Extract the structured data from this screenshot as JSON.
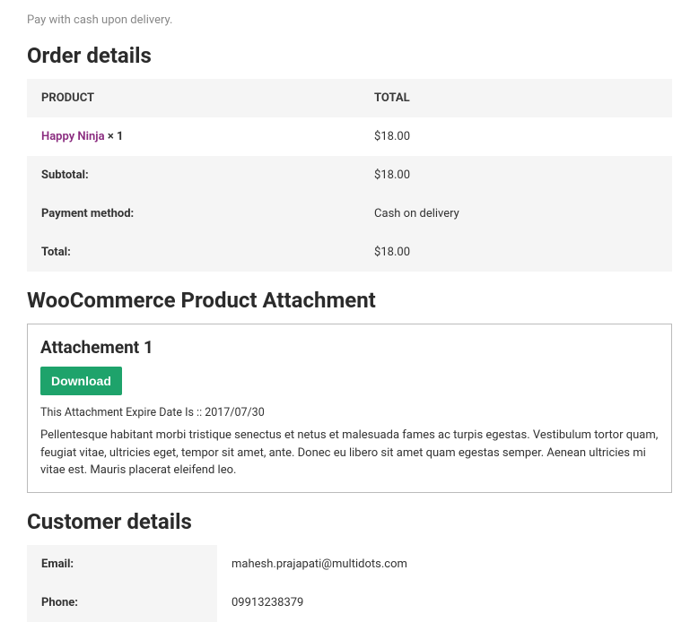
{
  "payment_note": "Pay with cash upon delivery.",
  "order_details": {
    "title": "Order details",
    "headers": {
      "product": "PRODUCT",
      "total": "TOTAL"
    },
    "items": [
      {
        "name": "Happy Ninja",
        "qty": "× 1",
        "total": "$18.00"
      }
    ],
    "subtotal_label": "Subtotal:",
    "subtotal_value": "$18.00",
    "payment_method_label": "Payment method:",
    "payment_method_value": "Cash on delivery",
    "total_label": "Total:",
    "total_value": "$18.00"
  },
  "attachment_section": {
    "title": "WooCommerce Product Attachment",
    "box_title": "Attachement 1",
    "download_label": "Download",
    "expire_text": "This Attachment Expire Date Is :: 2017/07/30",
    "description": "Pellentesque habitant morbi tristique senectus et netus et malesuada fames ac turpis egestas. Vestibulum tortor quam, feugiat vitae, ultricies eget, tempor sit amet, ante. Donec eu libero sit amet quam egestas semper. Aenean ultricies mi vitae est. Mauris placerat eleifend leo."
  },
  "customer_details": {
    "title": "Customer details",
    "email_label": "Email:",
    "email_value": "mahesh.prajapati@multidots.com",
    "phone_label": "Phone:",
    "phone_value": "09913238379"
  }
}
